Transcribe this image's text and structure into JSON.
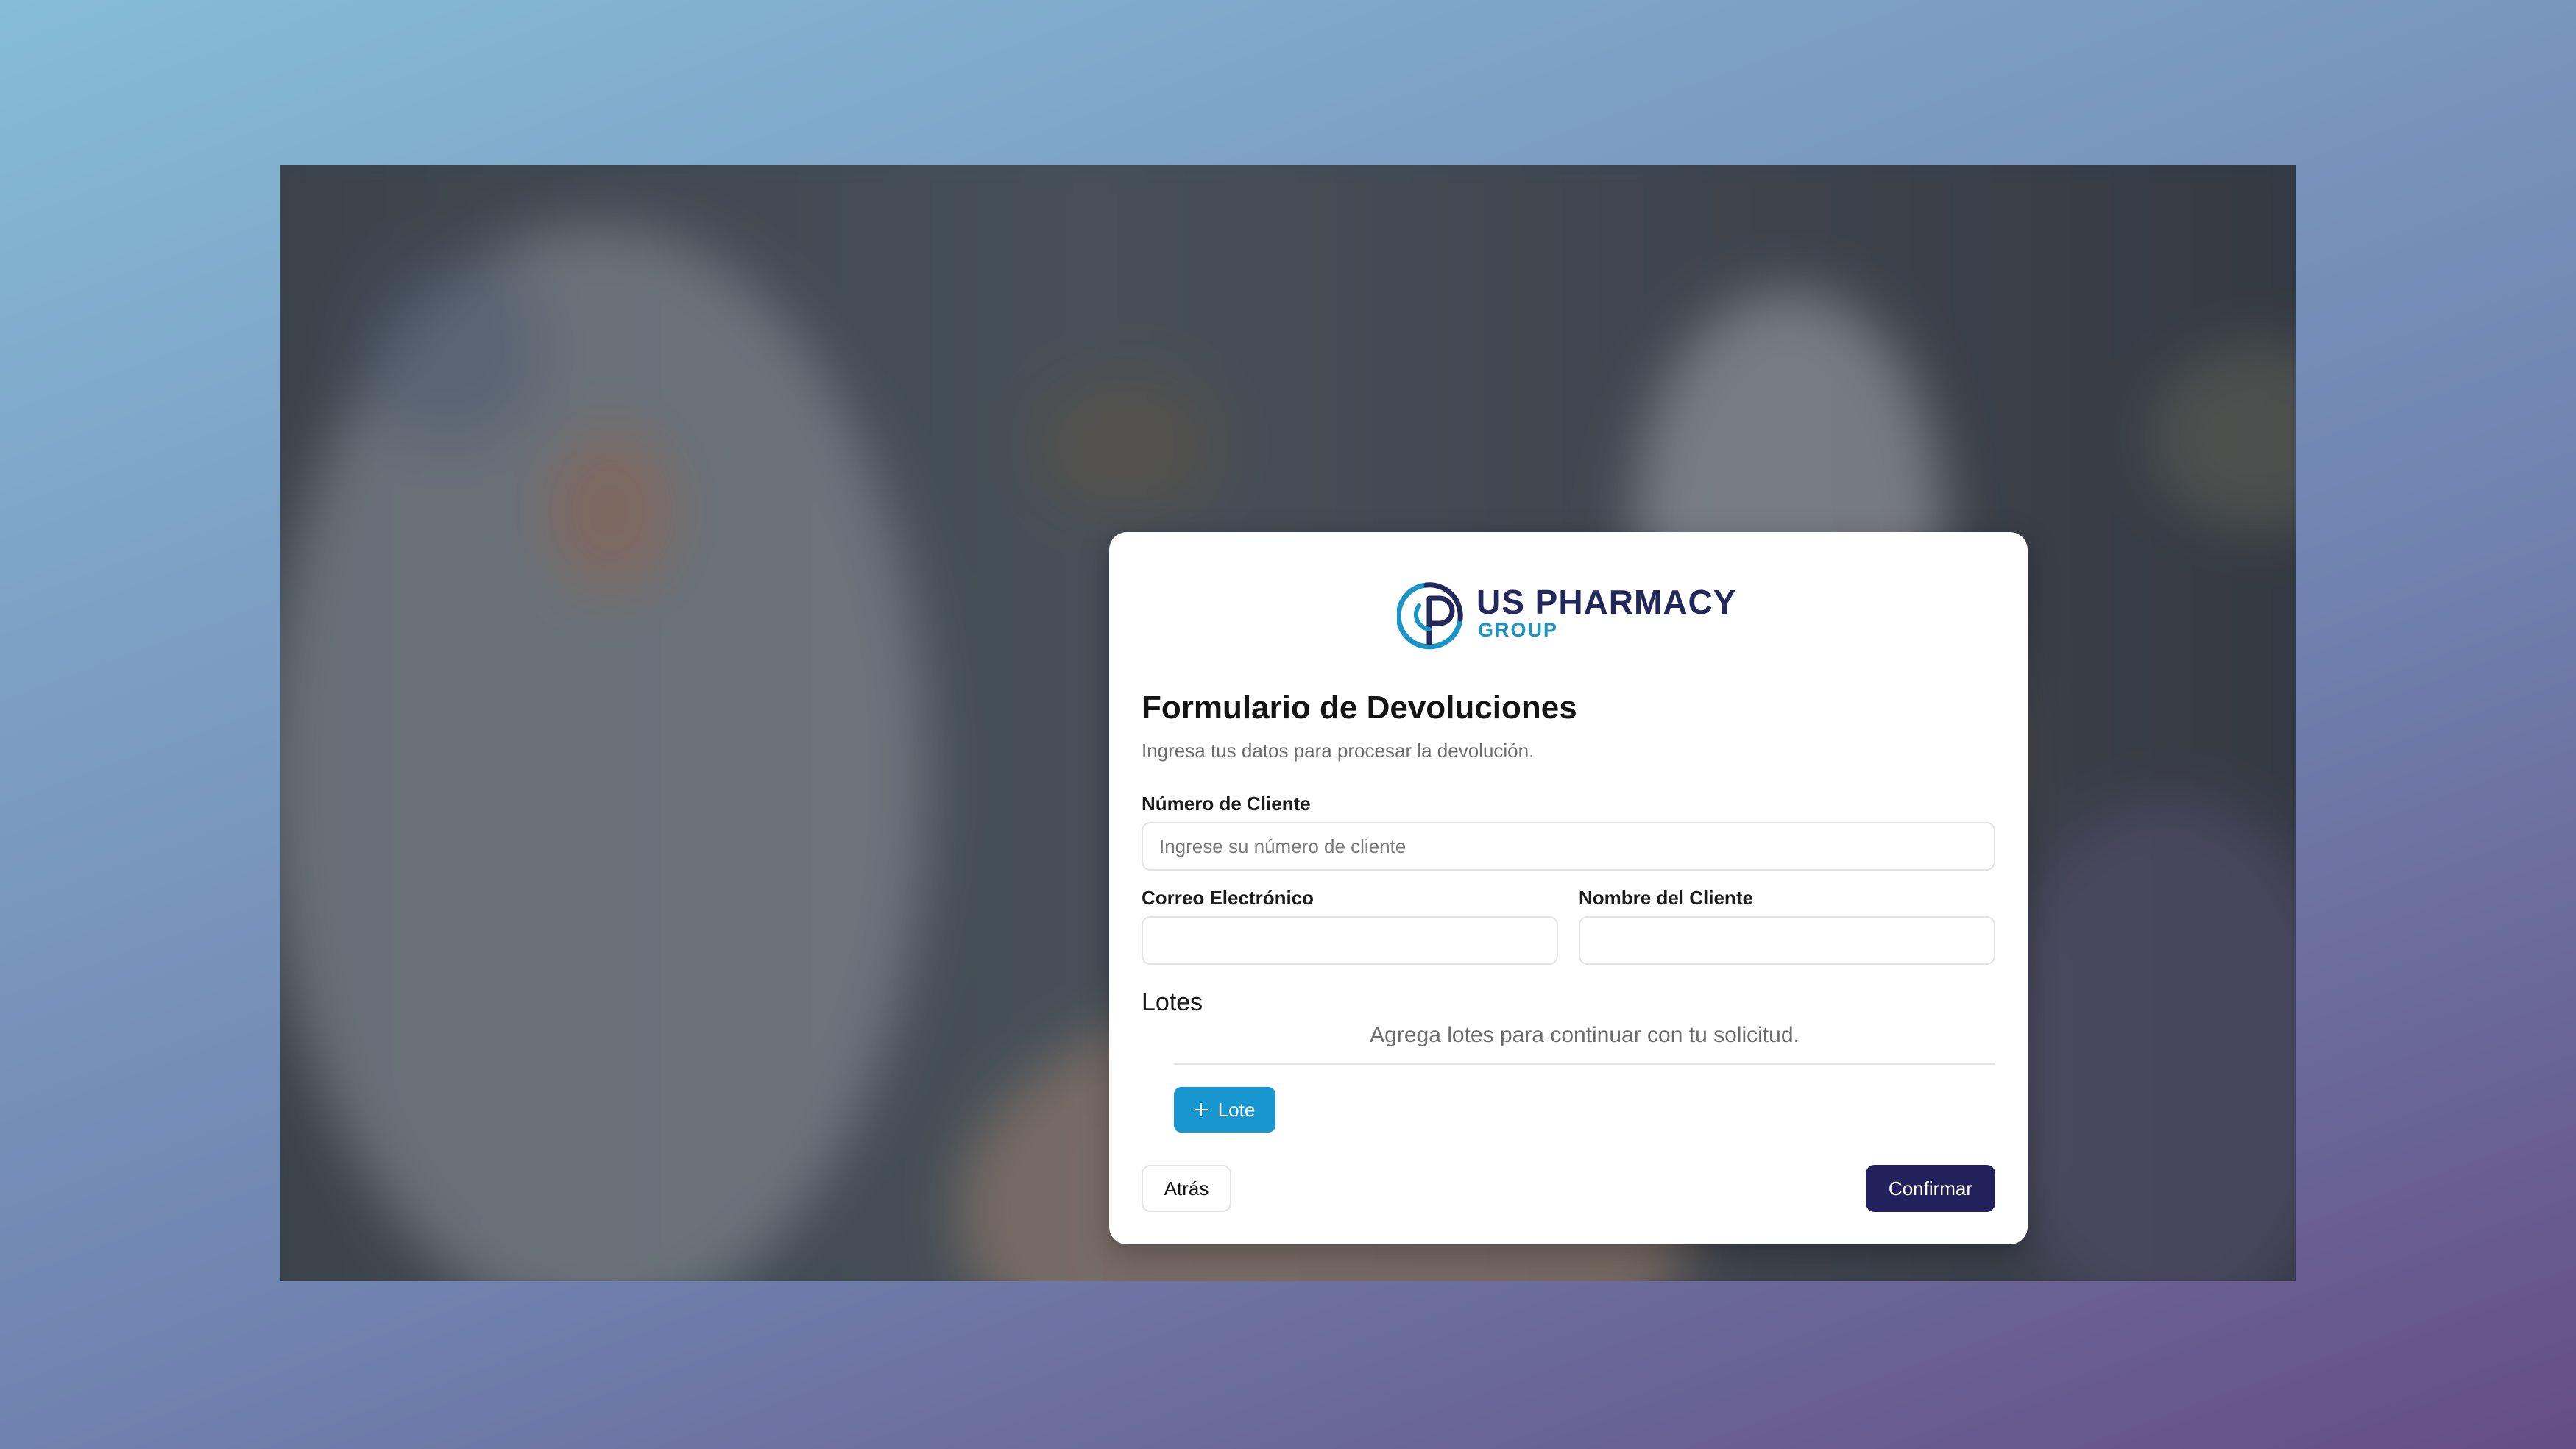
{
  "brand": {
    "name": "US PHARMACY",
    "sub": "GROUP",
    "primary_color": "#23285c",
    "accent_color": "#1a93c6"
  },
  "form": {
    "title": "Formulario de Devoluciones",
    "subtitle": "Ingresa tus datos para procesar la devolución.",
    "client_number": {
      "label": "Número de Cliente",
      "placeholder": "Ingrese su número de cliente",
      "value": ""
    },
    "email": {
      "label": "Correo Electrónico",
      "placeholder": "",
      "value": ""
    },
    "client_name": {
      "label": "Nombre del Cliente",
      "placeholder": "",
      "value": ""
    }
  },
  "lots": {
    "title": "Lotes",
    "empty_message": "Agrega lotes para continuar con tu solicitud.",
    "add_label": "Lote",
    "add_icon": "plus-icon"
  },
  "actions": {
    "back_label": "Atrás",
    "confirm_label": "Confirmar",
    "confirm_color": "#23215c",
    "add_color": "#1896cf"
  }
}
